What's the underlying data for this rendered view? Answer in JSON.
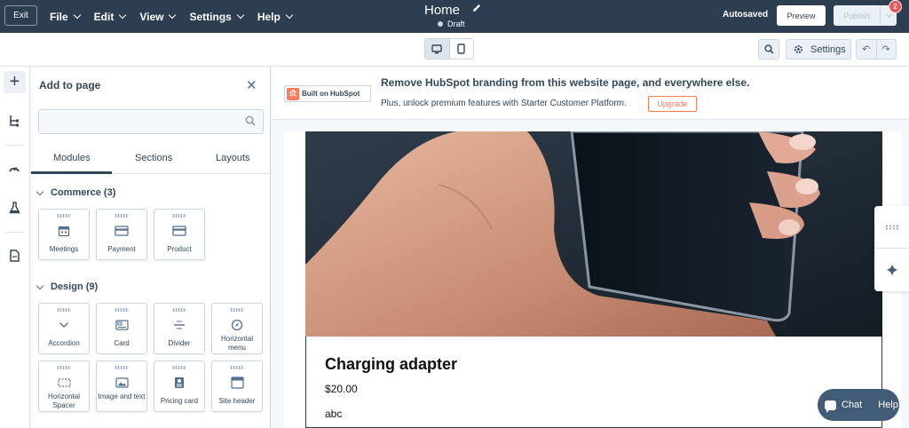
{
  "topbar": {
    "exit_label": "Exit",
    "menus": [
      "File",
      "Edit",
      "View",
      "Settings",
      "Help"
    ],
    "page_title": "Home",
    "status": "Draft",
    "autosaved": "Autosaved",
    "preview_label": "Preview",
    "publish_label": "Publish",
    "notification_count": "2"
  },
  "toolbar": {
    "settings_label": "Settings"
  },
  "panel": {
    "title": "Add to page",
    "search_placeholder": "",
    "tabs": [
      "Modules",
      "Sections",
      "Layouts"
    ],
    "active_tab": "Modules",
    "sections": [
      {
        "heading": "Commerce (3)",
        "items": [
          "Meetings",
          "Payment",
          "Product"
        ]
      },
      {
        "heading": "Design (9)",
        "items": [
          "Accordion",
          "Card",
          "Divider",
          "Horizontal menu",
          "Horizontal Spacer",
          "Image and text",
          "Pricing card",
          "Site header"
        ]
      }
    ]
  },
  "banner": {
    "badge_label": "Built on HubSpot",
    "title": "Remove HubSpot branding from this website page, and everywhere else.",
    "subtitle": "Plus, unlock premium features with Starter Customer Platform.",
    "upgrade_label": "Upgrade"
  },
  "product": {
    "name": "Charging adapter",
    "price": "$20.00",
    "description": "abc"
  },
  "chat": {
    "chat_label": "Chat",
    "help_label": "Help"
  },
  "colors": {
    "topbar": "#2d3e50",
    "accent_orange": "#ff7a59",
    "badge_red": "#f2545b",
    "chat_bg": "#425b76"
  }
}
